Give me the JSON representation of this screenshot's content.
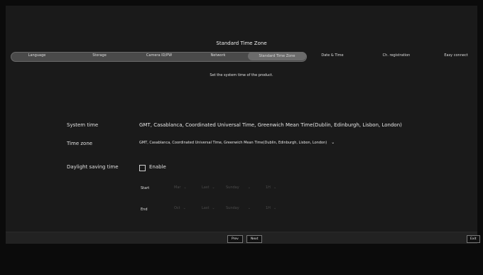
{
  "header": {
    "title": "Standard Time Zone"
  },
  "steps": [
    {
      "label": "Language"
    },
    {
      "label": "Storage"
    },
    {
      "label": "Camera ID/PW"
    },
    {
      "label": "Network"
    },
    {
      "label": "Standard Time Zone"
    },
    {
      "label": "Date & Time"
    },
    {
      "label": "Ch. registration"
    },
    {
      "label": "Easy connect"
    }
  ],
  "instruction": "Set the system time of the product.",
  "system_time": {
    "label": "System time",
    "value": "GMT, Casablanca, Coordinated Universal Time, Greenwich Mean Time(Dublin, Edinburgh, Lisbon, London)"
  },
  "time_zone": {
    "label": "Time zone",
    "selected": "GMT, Casablanca, Coordinated Universal Time, Greenwich Mean Time(Dublin, Edinburgh, Lisbon, London)"
  },
  "dst": {
    "label": "Daylight saving time",
    "enable_label": "Enable",
    "enabled": false,
    "start": {
      "label": "Start",
      "month": "Mar",
      "week": "Last",
      "day": "Sunday",
      "hour": "1H"
    },
    "end": {
      "label": "End",
      "month": "Oct",
      "week": "Last",
      "day": "Sunday",
      "hour": "1H"
    }
  },
  "footer": {
    "prev": "Prev",
    "next": "Next",
    "exit": "Exit"
  },
  "icons": {
    "dropdown": "chevron-down-icon",
    "checkbox": "checkbox-unchecked-icon"
  }
}
